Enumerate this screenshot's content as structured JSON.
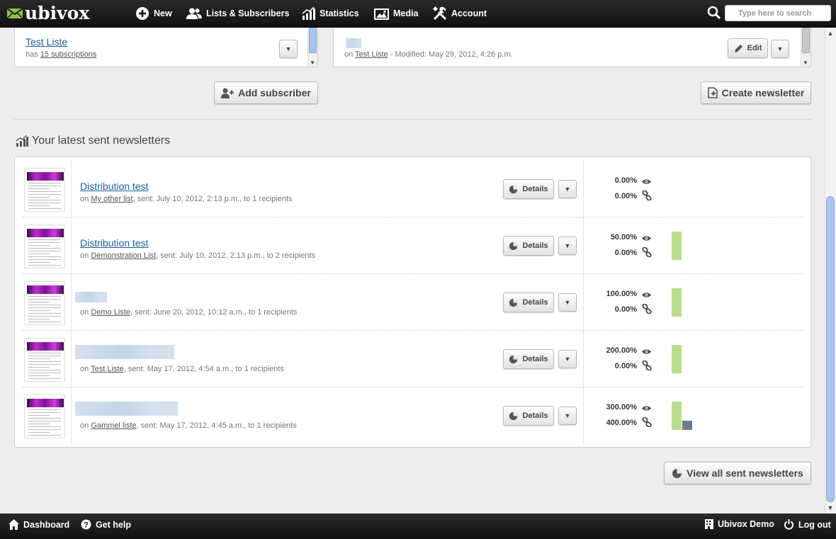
{
  "app": {
    "logo_text": "ubivox"
  },
  "nav": {
    "new": "New",
    "lists": "Lists & Subscribers",
    "statistics": "Statistics",
    "media": "Media",
    "account": "Account",
    "search_placeholder": "Type here to search"
  },
  "lists_card": {
    "list_name": "Test Liste",
    "has_prefix": "has",
    "subscriptions": "15 subscriptions"
  },
  "drafts_card": {
    "on_prefix": "on",
    "list_name": "Test Liste",
    "modified": "- Modified: May 29, 2012, 4:26 p.m.",
    "edit_label": "Edit"
  },
  "actions": {
    "add_subscriber": "Add subscriber",
    "create_newsletter": "Create newsletter",
    "view_all": "View all sent newsletters"
  },
  "section_title": "Your latest sent newsletters",
  "details_label": "Details",
  "dropdown_glyph": "▼",
  "newsletters": [
    {
      "title": "Distribution test",
      "on": "on",
      "list": "My other list",
      "info": ", sent: July 10, 2012, 2:13 p.m., to 1 recipients",
      "open_rate": "0.00%",
      "click_rate": "0.00%",
      "open_value": 0.0,
      "click_value": 0.0
    },
    {
      "title": "Distribution test",
      "on": "on",
      "list": "Demonstration List",
      "info": ", sent: July 10, 2012, 2:13 p.m., to 2 recipients",
      "open_rate": "50.00%",
      "click_rate": "0.00%",
      "open_value": 50.0,
      "click_value": 0.0
    },
    {
      "title": "",
      "on": "on",
      "list": "Demo Liste",
      "info": ", sent: June 20, 2012, 10:12 a.m., to 1 recipients",
      "open_rate": "100.00%",
      "click_rate": "0.00%",
      "open_value": 100.0,
      "click_value": 0.0
    },
    {
      "title": "",
      "on": "on",
      "list": "Test Liste",
      "info": ", sent: May 17, 2012, 4:54 a.m., to 1 recipients",
      "open_rate": "200.00%",
      "click_rate": "0.00%",
      "open_value": 200.0,
      "click_value": 0.0
    },
    {
      "title": "",
      "on": "on",
      "list": "Gammel liste",
      "info": ", sent: May 17, 2012, 4:45 a.m., to 1 recipients",
      "open_rate": "300.00%",
      "click_rate": "400.00%",
      "open_value": 300.0,
      "click_value": 400.0
    }
  ],
  "footer": {
    "dashboard": "Dashboard",
    "help": "Get help",
    "account_name": "Ubivox Demo",
    "logout": "Log out"
  },
  "colors": {
    "open_bar": "#b9dc8e",
    "click_bar": "#6d7c8c",
    "link": "#1a5f9a",
    "logo_green": "#8bc34a"
  }
}
